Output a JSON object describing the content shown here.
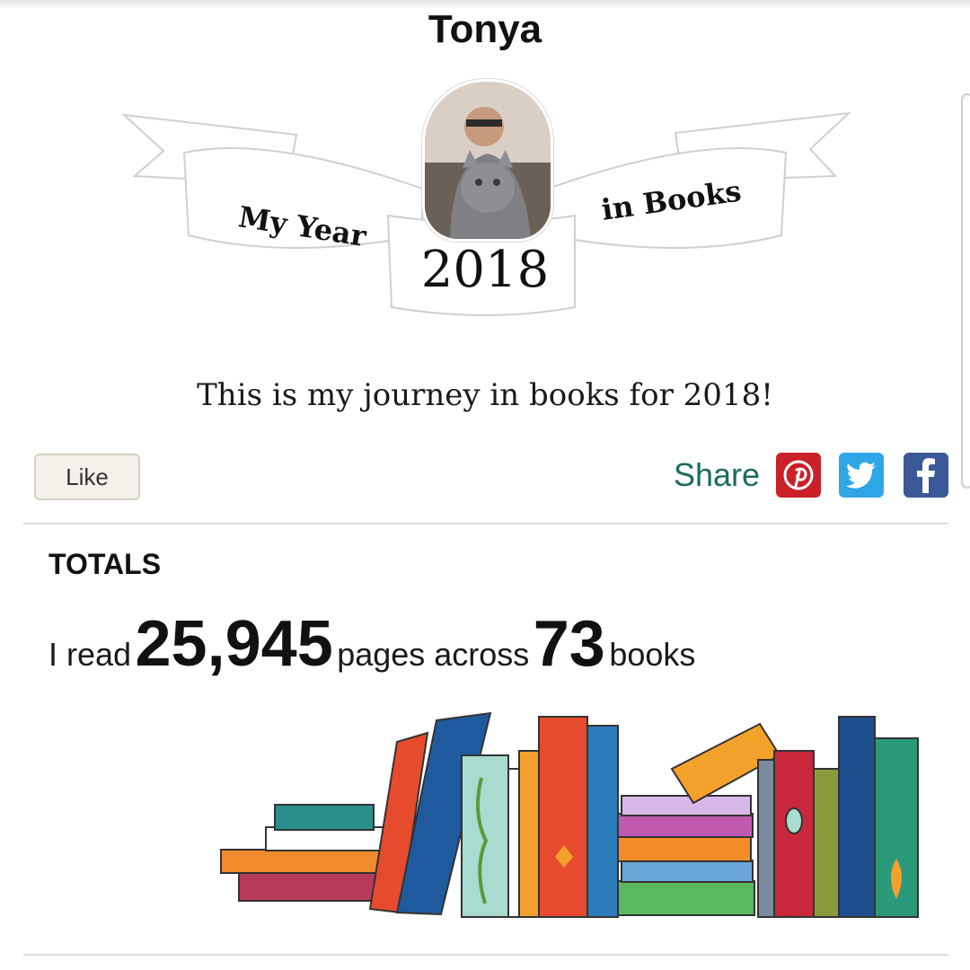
{
  "profile": {
    "name": "Tonya"
  },
  "banner": {
    "left_text": "My Year",
    "right_text": "in Books",
    "year": "2018"
  },
  "description": "This is my journey in books for 2018!",
  "actions": {
    "like_label": "Like",
    "share_label": "Share",
    "share_networks": [
      "pinterest-icon",
      "twitter-icon",
      "facebook-icon"
    ]
  },
  "totals": {
    "heading": "TOTALS",
    "prefix": "I read",
    "pages": "25,945",
    "middle": "pages across",
    "books": "73",
    "suffix": "books"
  },
  "colors": {
    "share_text": "#1b6b5e",
    "pinterest": "#cb2027",
    "twitter": "#2fa6e6",
    "facebook": "#3b5998",
    "like_bg": "#f4f1ea"
  }
}
